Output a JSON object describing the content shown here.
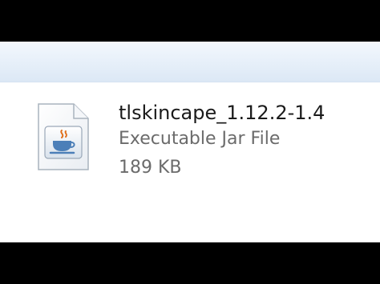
{
  "file": {
    "name": "tlskincape_1.12.2-1.4",
    "type": "Executable Jar File",
    "size": "189 KB",
    "icon": "java-jar-file-icon"
  },
  "colors": {
    "window_background": "#ffffff",
    "toolbar_gradient_top": "#f3f8fd",
    "toolbar_gradient_bottom": "#dce8f5",
    "name_text": "#1a1a1a",
    "detail_text": "#6b6b6b",
    "java_cup": "#4c7fb8",
    "java_steam": "#e0701d"
  }
}
